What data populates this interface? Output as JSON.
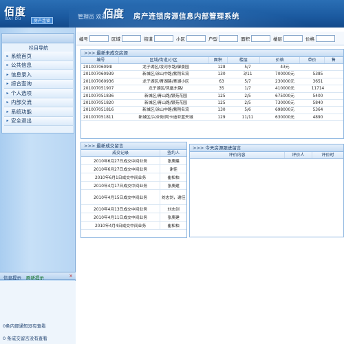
{
  "header": {
    "logo_text": "佰度",
    "logo_sub": "BAI DU",
    "logo_badge": "房产连锁",
    "welcome": "管理员  欢迎您！",
    "brand": "佰度",
    "title": "房产连锁房源信息内部管理系统"
  },
  "sidebar": {
    "nav_title": "栏目导航",
    "items": [
      {
        "label": "系统首页"
      },
      {
        "label": "公共信息"
      },
      {
        "label": "信息录入"
      },
      {
        "label": "综合查询"
      },
      {
        "label": "个人选项"
      },
      {
        "label": "内部交流"
      },
      {
        "label": "系统功能"
      },
      {
        "label": "安全退出"
      }
    ],
    "tips_label": "信息提示",
    "tips_refresh": "刷新提示",
    "tips_close": "×",
    "tips": [
      "0条内部通知没有查看",
      "0 条成交留言没有查看"
    ]
  },
  "search": {
    "fields": [
      "编号",
      "区域",
      "街道",
      "小区",
      "户型",
      "面积",
      "楼层",
      "价格"
    ]
  },
  "latest_deals": {
    "title": ">>> 最新未成交房源",
    "columns": [
      "编号",
      "区域/街道/小区",
      "面积",
      "楼层",
      "价格",
      "单价",
      "售"
    ],
    "rows": [
      {
        "id": "20100706094l",
        "area": "龙子湖区/凌河东路/御景园",
        "size": "128",
        "floor": "5/7",
        "price": "43元",
        "unit": ""
      },
      {
        "id": "20100706093​9",
        "area": "新城区/涂山中路/紫荆名流",
        "size": "130",
        "floor": "3/11",
        "price": "700000元",
        "unit": "5385"
      },
      {
        "id": "20100706093​6",
        "area": "龙子湖区/青湖路/青湖小区",
        "size": "63",
        "floor": "5/7",
        "price": "230000元",
        "unit": "3651"
      },
      {
        "id": "201007051907",
        "area": "龙子湖区/凤凰东路/",
        "size": "35",
        "floor": "1/7",
        "price": "410000元",
        "unit": "11714"
      },
      {
        "id": "201007051836",
        "area": "新城区/青山路/银苑花园",
        "size": "125",
        "floor": "2/5",
        "price": "675000元",
        "unit": "5400"
      },
      {
        "id": "201007051820",
        "area": "新城区/青山路/银苑花园",
        "size": "125",
        "floor": "2/5",
        "price": "730000元",
        "unit": "5840"
      },
      {
        "id": "201007051816",
        "area": "新城区/涂山中路/紫荆名流",
        "size": "130",
        "floor": "5/6",
        "price": "698000元",
        "unit": "5364"
      },
      {
        "id": "201007051811",
        "area": "新城区/兴业街/阿卡迪亚蓝天城",
        "size": "129",
        "floor": "11/11",
        "price": "630000元",
        "unit": "4890"
      }
    ]
  },
  "deal_messages": {
    "title": ">>> 最新成交留言",
    "columns": [
      "成交记录",
      "签约人"
    ],
    "rows": [
      {
        "record": "2010年6月27日成交中间业务",
        "signer": "张庚建"
      },
      {
        "record": "2010年6月27日成交中间业务",
        "signer": "谢佳"
      },
      {
        "record": "2010年6月1日成交中间业务",
        "signer": "崔松柏"
      },
      {
        "record": "2010年4月17日成交中间业务",
        "signer": "张庚建"
      },
      {
        "record": "2010年4月15日成交中间业务",
        "signer": "刘志剑，谢佳"
      },
      {
        "record": "2010年4月13日成交中间业务",
        "signer": "刘志剑"
      },
      {
        "record": "2010年4月11日成交中间业务",
        "signer": "张庚建"
      },
      {
        "record": "2010年4月4日成交中间业务",
        "signer": "崔松柏"
      }
    ]
  },
  "evaluations": {
    "title": ">>> 今天房源跟进留言",
    "columns": [
      "评价内容",
      "评价人",
      "评价时"
    ]
  }
}
